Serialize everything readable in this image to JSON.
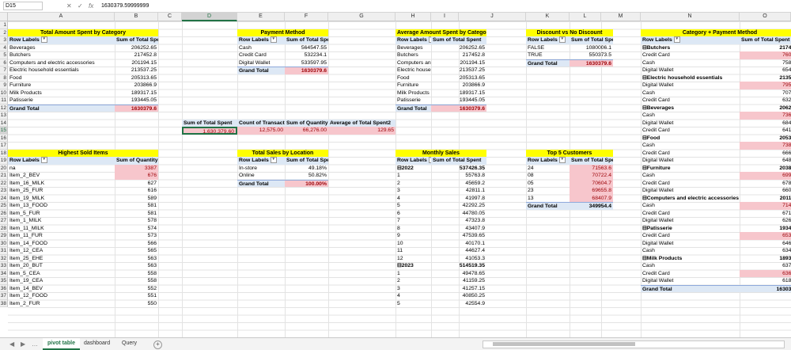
{
  "formula_bar": {
    "name_box": "D15",
    "cancel_icon": "✕",
    "enter_icon": "✓",
    "fx_label": "fx",
    "formula": "1630379.59999999"
  },
  "columns": [
    "A",
    "B",
    "C",
    "D",
    "E",
    "F",
    "G",
    "H",
    "I",
    "J",
    "K",
    "L",
    "M",
    "N",
    "O"
  ],
  "selected_column": "D",
  "selected_row": "15",
  "rows": [
    "1",
    "2",
    "3",
    "4",
    "5",
    "6",
    "7",
    "8",
    "9",
    "10",
    "11",
    "12",
    "13",
    "14",
    "15",
    "16",
    "17",
    "18",
    "19",
    "20",
    "21",
    "22",
    "23",
    "24",
    "25",
    "26",
    "27",
    "28",
    "29",
    "30",
    "31",
    "32",
    "33",
    "34",
    "35",
    "36",
    "37",
    "38"
  ],
  "pivots": {
    "category": {
      "title": "Total Amount Spent by Category",
      "row_label": "Row Labels",
      "value_label": "Sum of Total Spent",
      "items": [
        {
          "label": "Beverages",
          "value": "206252.65",
          "pink": false
        },
        {
          "label": "Butchers",
          "value": "217452.8",
          "pink": false
        },
        {
          "label": "Computers and electric accessories",
          "value": "201194.15",
          "pink": false
        },
        {
          "label": "Electric household essentials",
          "value": "213537.25",
          "pink": false
        },
        {
          "label": "Food",
          "value": "205313.65",
          "pink": false
        },
        {
          "label": "Furniture",
          "value": "203866.9",
          "pink": false
        },
        {
          "label": "Milk Products",
          "value": "189317.15",
          "pink": false
        },
        {
          "label": "Patisserie",
          "value": "193445.05",
          "pink": false
        }
      ],
      "total_label": "Grand Total",
      "total_value": "1630379.6"
    },
    "payment": {
      "title": "Payment Method",
      "row_label": "Row Labels",
      "value_label": "Sum of Total Spent",
      "items": [
        {
          "label": "Cash",
          "value": "564547.55",
          "pink": false
        },
        {
          "label": "Credit Card",
          "value": "532234.1",
          "pink": false
        },
        {
          "label": "Digital Wallet",
          "value": "533597.95",
          "pink": false
        }
      ],
      "total_label": "Grand Total",
      "total_value": "1630379.6"
    },
    "average": {
      "title": "Average Amount Spent by Category",
      "row_label": "Row Labels",
      "value_label": "Sum of Total Spent",
      "items": [
        {
          "label": "Beverages",
          "value": "206252.65",
          "pink": false
        },
        {
          "label": "Butchers",
          "value": "217452.8",
          "pink": false
        },
        {
          "label": "Computers and electric accessories",
          "value": "201194.15",
          "pink": false
        },
        {
          "label": "Electric household essentials",
          "value": "213537.25",
          "pink": false
        },
        {
          "label": "Food",
          "value": "205313.65",
          "pink": false
        },
        {
          "label": "Furniture",
          "value": "203866.9",
          "pink": false
        },
        {
          "label": "Milk Products",
          "value": "189317.15",
          "pink": false
        },
        {
          "label": "Patisserie",
          "value": "193445.05",
          "pink": false
        }
      ],
      "total_label": "Grand Total",
      "total_value": "1630379.6"
    },
    "discount": {
      "title": "Discount vs No Discount",
      "row_label": "Row Labels",
      "value_label": "Sum of Total Spent",
      "items": [
        {
          "label": "FALSE",
          "value": "1080006.1",
          "pink": false
        },
        {
          "label": "TRUE",
          "value": "550373.5",
          "pink": false
        }
      ],
      "total_label": "Grand Total",
      "total_value": "1630379.6"
    },
    "summary": {
      "headers": [
        "Sum of Total Spent",
        "Count of Transaction",
        "Sum of Quantity",
        "Average of Total Spent2"
      ],
      "values": [
        "1,630,379.60",
        "12,575.00",
        "66,276.00",
        "129.65"
      ]
    },
    "highest": {
      "title": "Highest Sold Items",
      "row_label": "Row Labels",
      "value_label": "Sum of Quantity",
      "items": [
        {
          "label": "na",
          "value": "3387",
          "pink": true
        },
        {
          "label": "Item_2_BEV",
          "value": "676",
          "pink": true
        },
        {
          "label": "Item_16_MILK",
          "value": "627",
          "pink": false
        },
        {
          "label": "Item_25_FUR",
          "value": "616",
          "pink": false
        },
        {
          "label": "Item_19_MILK",
          "value": "589",
          "pink": false
        },
        {
          "label": "Item_13_FOOD",
          "value": "581",
          "pink": false
        },
        {
          "label": "Item_5_FUR",
          "value": "581",
          "pink": false
        },
        {
          "label": "Item_1_MILK",
          "value": "578",
          "pink": false
        },
        {
          "label": "Item_11_MILK",
          "value": "574",
          "pink": false
        },
        {
          "label": "Item_11_FUR",
          "value": "573",
          "pink": false
        },
        {
          "label": "Item_14_FOOD",
          "value": "566",
          "pink": false
        },
        {
          "label": "Item_12_CEA",
          "value": "565",
          "pink": false
        },
        {
          "label": "Item_25_EHE",
          "value": "563",
          "pink": false
        },
        {
          "label": "Item_20_BUT",
          "value": "563",
          "pink": false
        },
        {
          "label": "Item_5_CEA",
          "value": "558",
          "pink": false
        },
        {
          "label": "Item_19_CEA",
          "value": "558",
          "pink": false
        },
        {
          "label": "Item_14_BEV",
          "value": "552",
          "pink": false
        },
        {
          "label": "Item_12_FOOD",
          "value": "551",
          "pink": false
        },
        {
          "label": "Item_2_FUR",
          "value": "550",
          "pink": false
        }
      ]
    },
    "location": {
      "title": "Total Sales by Location",
      "row_label": "Row Labels",
      "value_label": "Sum of Total Spent",
      "items": [
        {
          "label": "In-store",
          "value": "49.18%",
          "pink": false
        },
        {
          "label": "Online",
          "value": "50.82%",
          "pink": false
        }
      ],
      "total_label": "Grand Total",
      "total_value": "100.00%"
    },
    "monthly": {
      "title": "Monthly Sales",
      "row_label": "Row Labels",
      "value_label": "Sum of Total Spent",
      "items": [
        {
          "label": "⊟2022",
          "value": "537426.35",
          "grp": true
        },
        {
          "label": "1",
          "value": "55763.8"
        },
        {
          "label": "2",
          "value": "45659.2"
        },
        {
          "label": "3",
          "value": "42811.1"
        },
        {
          "label": "4",
          "value": "41997.8"
        },
        {
          "label": "5",
          "value": "42292.25"
        },
        {
          "label": "6",
          "value": "44780.05"
        },
        {
          "label": "7",
          "value": "47323.8"
        },
        {
          "label": "8",
          "value": "43407.9"
        },
        {
          "label": "9",
          "value": "47539.65"
        },
        {
          "label": "10",
          "value": "40170.1"
        },
        {
          "label": "11",
          "value": "44627.4"
        },
        {
          "label": "12",
          "value": "41053.3"
        },
        {
          "label": "⊟2023",
          "value": "514519.35",
          "grp": true
        },
        {
          "label": "1",
          "value": "49478.65"
        },
        {
          "label": "2",
          "value": "41159.25"
        },
        {
          "label": "3",
          "value": "41257.15"
        },
        {
          "label": "4",
          "value": "40850.25"
        },
        {
          "label": "5",
          "value": "42554.9"
        }
      ]
    },
    "customers": {
      "title": "Top 5 Customers",
      "row_label": "Row Labels",
      "value_label": "Sum of Total Spent",
      "items": [
        {
          "label": "24",
          "value": "71563.6",
          "pink": true
        },
        {
          "label": "08",
          "value": "70722.4",
          "pink": true
        },
        {
          "label": "05",
          "value": "70604.7",
          "pink": true
        },
        {
          "label": "23",
          "value": "69655.8",
          "pink": true
        },
        {
          "label": "13",
          "value": "68407.9",
          "pink": true
        }
      ],
      "total_label": "Grand Total",
      "total_value": "349954.4"
    },
    "catpay": {
      "title": "Category + Payment Method",
      "row_label": "Row Labels",
      "value_label": "Sum of Total Spent",
      "items": [
        {
          "label": "⊟Butchers",
          "value": "217452",
          "grp": true
        },
        {
          "label": "Credit Card",
          "value": "76073",
          "pink": true
        },
        {
          "label": "Cash",
          "value": "75879"
        },
        {
          "label": "Digital Wallet",
          "value": "65497"
        },
        {
          "label": "⊟Electric household essentials",
          "value": "213537",
          "grp": true
        },
        {
          "label": "Digital Wallet",
          "value": "79560",
          "pink": true
        },
        {
          "label": "Cash",
          "value": "70731"
        },
        {
          "label": "Credit Card",
          "value": "63236"
        },
        {
          "label": "⊟Beverages",
          "value": "206252",
          "grp": true
        },
        {
          "label": "Cash",
          "value": "73625",
          "pink": true
        },
        {
          "label": "Digital Wallet",
          "value": "68469"
        },
        {
          "label": "Credit Card",
          "value": "64163"
        },
        {
          "label": "⊟Food",
          "value": "205313",
          "grp": true
        },
        {
          "label": "Cash",
          "value": "73859",
          "pink": true
        },
        {
          "label": "Credit Card",
          "value": "66653"
        },
        {
          "label": "Digital Wallet",
          "value": "64802"
        },
        {
          "label": "⊟Furniture",
          "value": "203866",
          "grp": true
        },
        {
          "label": "Cash",
          "value": "69958",
          "pink": true
        },
        {
          "label": "Credit Card",
          "value": "67892"
        },
        {
          "label": "Digital Wallet",
          "value": "66077"
        },
        {
          "label": "⊟Computers and electric accessories",
          "value": "201194",
          "grp": true
        },
        {
          "label": "Cash",
          "value": "71439",
          "pink": true
        },
        {
          "label": "Credit Card",
          "value": "67107"
        },
        {
          "label": "Digital Wallet",
          "value": "62648"
        },
        {
          "label": "⊟Patisserie",
          "value": "193445",
          "grp": true
        },
        {
          "label": "Credit Card",
          "value": "65359",
          "pink": true
        },
        {
          "label": "Digital Wallet",
          "value": "64657"
        },
        {
          "label": "Cash",
          "value": "63430"
        },
        {
          "label": "⊟Milk Products",
          "value": "189317",
          "grp": true
        },
        {
          "label": "Cash",
          "value": "63723"
        },
        {
          "label": "Credit Card",
          "value": "63629",
          "pink": true
        },
        {
          "label": "Digital Wallet",
          "value": "61875"
        }
      ],
      "total_label": "Grand Total",
      "total_value": "1630379"
    }
  },
  "tabs": [
    {
      "label": "pivot table",
      "active": true
    },
    {
      "label": "dashboard",
      "active": false
    },
    {
      "label": "Query",
      "active": false
    }
  ],
  "tab_nav": {
    "prev": "◀",
    "next": "▶",
    "more": "…",
    "add": "+"
  }
}
